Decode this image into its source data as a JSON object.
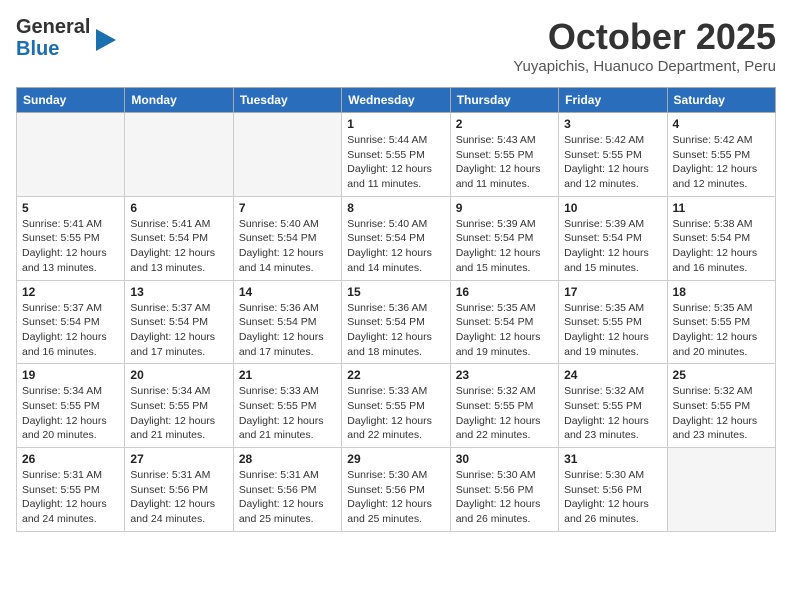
{
  "header": {
    "logo_line1": "General",
    "logo_line2": "Blue",
    "month": "October 2025",
    "location": "Yuyapichis, Huanuco Department, Peru"
  },
  "days_of_week": [
    "Sunday",
    "Monday",
    "Tuesday",
    "Wednesday",
    "Thursday",
    "Friday",
    "Saturday"
  ],
  "weeks": [
    [
      {
        "day": "",
        "info": ""
      },
      {
        "day": "",
        "info": ""
      },
      {
        "day": "",
        "info": ""
      },
      {
        "day": "1",
        "info": "Sunrise: 5:44 AM\nSunset: 5:55 PM\nDaylight: 12 hours\nand 11 minutes."
      },
      {
        "day": "2",
        "info": "Sunrise: 5:43 AM\nSunset: 5:55 PM\nDaylight: 12 hours\nand 11 minutes."
      },
      {
        "day": "3",
        "info": "Sunrise: 5:42 AM\nSunset: 5:55 PM\nDaylight: 12 hours\nand 12 minutes."
      },
      {
        "day": "4",
        "info": "Sunrise: 5:42 AM\nSunset: 5:55 PM\nDaylight: 12 hours\nand 12 minutes."
      }
    ],
    [
      {
        "day": "5",
        "info": "Sunrise: 5:41 AM\nSunset: 5:55 PM\nDaylight: 12 hours\nand 13 minutes."
      },
      {
        "day": "6",
        "info": "Sunrise: 5:41 AM\nSunset: 5:54 PM\nDaylight: 12 hours\nand 13 minutes."
      },
      {
        "day": "7",
        "info": "Sunrise: 5:40 AM\nSunset: 5:54 PM\nDaylight: 12 hours\nand 14 minutes."
      },
      {
        "day": "8",
        "info": "Sunrise: 5:40 AM\nSunset: 5:54 PM\nDaylight: 12 hours\nand 14 minutes."
      },
      {
        "day": "9",
        "info": "Sunrise: 5:39 AM\nSunset: 5:54 PM\nDaylight: 12 hours\nand 15 minutes."
      },
      {
        "day": "10",
        "info": "Sunrise: 5:39 AM\nSunset: 5:54 PM\nDaylight: 12 hours\nand 15 minutes."
      },
      {
        "day": "11",
        "info": "Sunrise: 5:38 AM\nSunset: 5:54 PM\nDaylight: 12 hours\nand 16 minutes."
      }
    ],
    [
      {
        "day": "12",
        "info": "Sunrise: 5:37 AM\nSunset: 5:54 PM\nDaylight: 12 hours\nand 16 minutes."
      },
      {
        "day": "13",
        "info": "Sunrise: 5:37 AM\nSunset: 5:54 PM\nDaylight: 12 hours\nand 17 minutes."
      },
      {
        "day": "14",
        "info": "Sunrise: 5:36 AM\nSunset: 5:54 PM\nDaylight: 12 hours\nand 17 minutes."
      },
      {
        "day": "15",
        "info": "Sunrise: 5:36 AM\nSunset: 5:54 PM\nDaylight: 12 hours\nand 18 minutes."
      },
      {
        "day": "16",
        "info": "Sunrise: 5:35 AM\nSunset: 5:54 PM\nDaylight: 12 hours\nand 19 minutes."
      },
      {
        "day": "17",
        "info": "Sunrise: 5:35 AM\nSunset: 5:55 PM\nDaylight: 12 hours\nand 19 minutes."
      },
      {
        "day": "18",
        "info": "Sunrise: 5:35 AM\nSunset: 5:55 PM\nDaylight: 12 hours\nand 20 minutes."
      }
    ],
    [
      {
        "day": "19",
        "info": "Sunrise: 5:34 AM\nSunset: 5:55 PM\nDaylight: 12 hours\nand 20 minutes."
      },
      {
        "day": "20",
        "info": "Sunrise: 5:34 AM\nSunset: 5:55 PM\nDaylight: 12 hours\nand 21 minutes."
      },
      {
        "day": "21",
        "info": "Sunrise: 5:33 AM\nSunset: 5:55 PM\nDaylight: 12 hours\nand 21 minutes."
      },
      {
        "day": "22",
        "info": "Sunrise: 5:33 AM\nSunset: 5:55 PM\nDaylight: 12 hours\nand 22 minutes."
      },
      {
        "day": "23",
        "info": "Sunrise: 5:32 AM\nSunset: 5:55 PM\nDaylight: 12 hours\nand 22 minutes."
      },
      {
        "day": "24",
        "info": "Sunrise: 5:32 AM\nSunset: 5:55 PM\nDaylight: 12 hours\nand 23 minutes."
      },
      {
        "day": "25",
        "info": "Sunrise: 5:32 AM\nSunset: 5:55 PM\nDaylight: 12 hours\nand 23 minutes."
      }
    ],
    [
      {
        "day": "26",
        "info": "Sunrise: 5:31 AM\nSunset: 5:55 PM\nDaylight: 12 hours\nand 24 minutes."
      },
      {
        "day": "27",
        "info": "Sunrise: 5:31 AM\nSunset: 5:56 PM\nDaylight: 12 hours\nand 24 minutes."
      },
      {
        "day": "28",
        "info": "Sunrise: 5:31 AM\nSunset: 5:56 PM\nDaylight: 12 hours\nand 25 minutes."
      },
      {
        "day": "29",
        "info": "Sunrise: 5:30 AM\nSunset: 5:56 PM\nDaylight: 12 hours\nand 25 minutes."
      },
      {
        "day": "30",
        "info": "Sunrise: 5:30 AM\nSunset: 5:56 PM\nDaylight: 12 hours\nand 26 minutes."
      },
      {
        "day": "31",
        "info": "Sunrise: 5:30 AM\nSunset: 5:56 PM\nDaylight: 12 hours\nand 26 minutes."
      },
      {
        "day": "",
        "info": ""
      }
    ]
  ]
}
